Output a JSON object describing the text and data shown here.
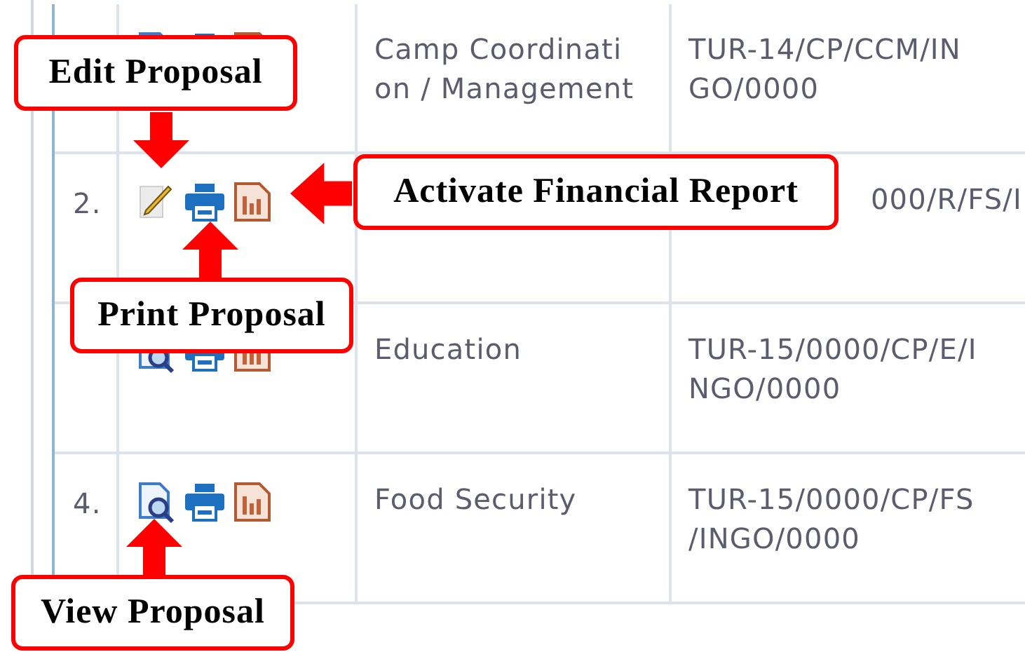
{
  "table": {
    "rows": [
      {
        "actions": [
          {
            "kind": "view"
          },
          {
            "kind": "print"
          },
          {
            "kind": "report"
          }
        ],
        "category_lines": [
          "Camp Coordinati",
          "on / Management"
        ],
        "code_lines": [
          "TUR-14/CP/CCM/IN",
          "GO/0000"
        ]
      },
      {
        "number": "2.",
        "actions": [
          {
            "kind": "edit"
          },
          {
            "kind": "print"
          },
          {
            "kind": "report"
          }
        ],
        "code_lines": [
          "000/R/FS/I"
        ]
      },
      {
        "actions": [
          {
            "kind": "view"
          },
          {
            "kind": "print"
          },
          {
            "kind": "report"
          }
        ],
        "category_lines": [
          "Education"
        ],
        "code_lines": [
          "TUR-15/0000/CP/E/I",
          "NGO/0000"
        ]
      },
      {
        "number": "4.",
        "actions": [
          {
            "kind": "view"
          },
          {
            "kind": "print"
          },
          {
            "kind": "report"
          }
        ],
        "category_lines": [
          "Food Security"
        ],
        "code_lines": [
          "TUR-15/0000/CP/FS",
          "/INGO/0000"
        ]
      }
    ]
  },
  "callouts": [
    {
      "text": "Edit Proposal",
      "kind": "down"
    },
    {
      "text": "Activate Financial Report",
      "kind": "left"
    },
    {
      "text": "Print Proposal",
      "kind": "up"
    },
    {
      "text": "View Proposal",
      "kind": "up"
    }
  ]
}
